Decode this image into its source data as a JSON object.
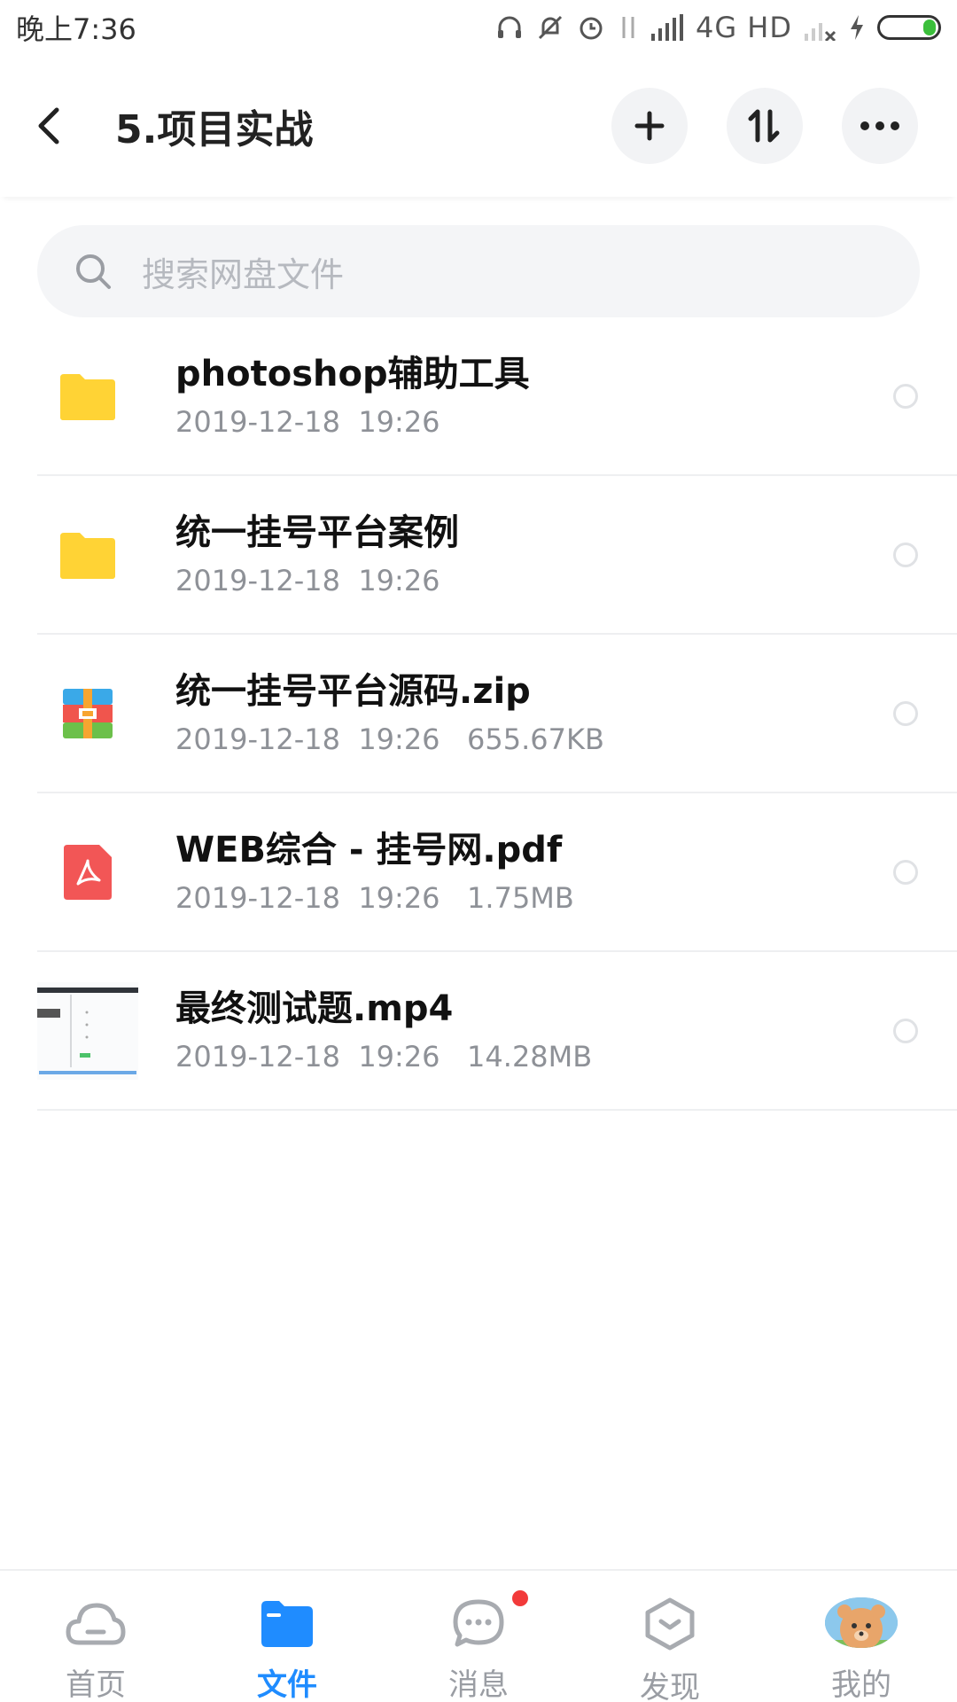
{
  "status_bar": {
    "time": "晚上7:36",
    "network": "4G HD"
  },
  "header": {
    "title": "5.项目实战"
  },
  "search": {
    "placeholder": "搜索网盘文件"
  },
  "files": [
    {
      "name": "photoshop辅助工具",
      "meta": "2019-12-18  19:26",
      "icon": "folder-icon"
    },
    {
      "name": "统一挂号平台案例",
      "meta": "2019-12-18  19:26",
      "icon": "folder-icon"
    },
    {
      "name": "统一挂号平台源码.zip",
      "meta": "2019-12-18  19:26   655.67KB",
      "icon": "zip-archive-icon"
    },
    {
      "name": "WEB综合 - 挂号网.pdf",
      "meta": "2019-12-18  19:26   1.75MB",
      "icon": "pdf-icon"
    },
    {
      "name": "最终测试题.mp4",
      "meta": "2019-12-18  19:26   14.28MB",
      "icon": "video-thumbnail"
    }
  ],
  "nav": {
    "home": "首页",
    "files": "文件",
    "messages": "消息",
    "discover": "发现",
    "mine": "我的"
  },
  "colors": {
    "accent": "#1f8cff",
    "folder": "#ffd335",
    "badge": "#f23a3a"
  }
}
